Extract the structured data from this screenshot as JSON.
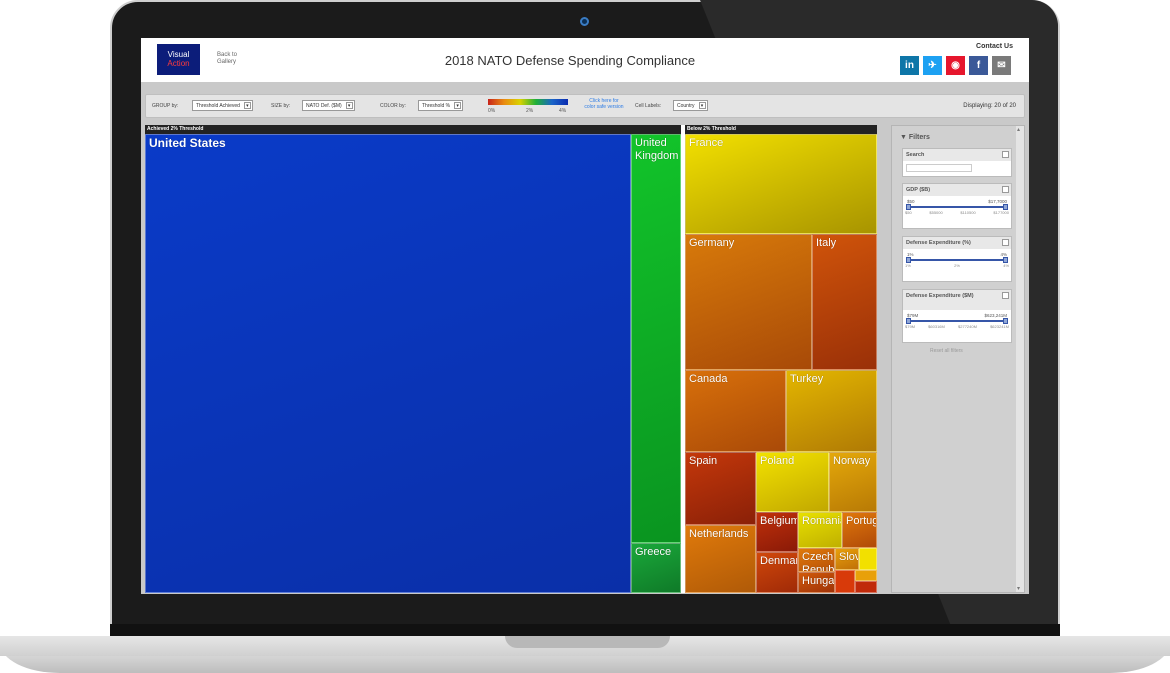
{
  "header": {
    "logo_line1": "Visual",
    "logo_line2": "Action",
    "back_line1": "Back to",
    "back_line2": "Gallery",
    "title": "2018 NATO Defense Spending Compliance",
    "contact": "Contact Us",
    "social": [
      {
        "icon": "linkedin-icon",
        "glyph": "in",
        "color": "#0e76a8"
      },
      {
        "icon": "twitter-icon",
        "glyph": "✈",
        "color": "#1da1f2"
      },
      {
        "icon": "weibo-icon",
        "glyph": "◉",
        "color": "#e6162d"
      },
      {
        "icon": "facebook-icon",
        "glyph": "f",
        "color": "#3b5998"
      },
      {
        "icon": "email-icon",
        "glyph": "✉",
        "color": "#7a7a7a"
      }
    ]
  },
  "controls": {
    "group_label": "GROUP by:",
    "group_value": "Threshold Achieved",
    "size_label": "SIZE by:",
    "size_value": "NATO Def. ($M)",
    "color_label": "COLOR by:",
    "color_value": "Threshold %",
    "legend_ticks": [
      "0%",
      "2%",
      "4%"
    ],
    "color_safe_line1": "Click here for",
    "color_safe_line2": "color safe version",
    "cell_labels_label": "Cell Labels:",
    "cell_labels_value": "Country",
    "displaying": "Displaying: 20 of 20"
  },
  "treemap": {
    "groups": [
      {
        "name": "Achieved 2% Threshold"
      },
      {
        "name": "Below 2% Threshold"
      }
    ],
    "cells": [
      {
        "label": "United States",
        "group": 0,
        "color": "#0a3bc8",
        "gradient": "#0a2fa8"
      },
      {
        "label": "United Kingdom",
        "group": 0,
        "color": "#12c42a",
        "gradient": "#0a9420"
      },
      {
        "label": "Greece",
        "group": 0,
        "color": "#1aa83a",
        "gradient": "#0f7a28"
      },
      {
        "label": "France",
        "group": 1,
        "color": "#f2e000",
        "gradient": "#a89400"
      },
      {
        "label": "Germany",
        "group": 1,
        "color": "#d87a0a",
        "gradient": "#a84a08"
      },
      {
        "label": "Italy",
        "group": 1,
        "color": "#d0540a",
        "gradient": "#9a3008"
      },
      {
        "label": "Canada",
        "group": 1,
        "color": "#d8700a",
        "gradient": "#aa4a08"
      },
      {
        "label": "Turkey",
        "group": 1,
        "color": "#e3b600",
        "gradient": "#b07a05"
      },
      {
        "label": "Spain",
        "group": 1,
        "color": "#c4380a",
        "gradient": "#8a2008"
      },
      {
        "label": "Poland",
        "group": 1,
        "color": "#f2e200",
        "gradient": "#c2a800"
      },
      {
        "label": "Norway",
        "group": 1,
        "color": "#e4a80a",
        "gradient": "#b87a05"
      },
      {
        "label": "Netherlands",
        "group": 1,
        "color": "#e07a0a",
        "gradient": "#b05a08"
      },
      {
        "label": "Belgium",
        "group": 1,
        "color": "#c0300a",
        "gradient": "#8a1a08"
      },
      {
        "label": "Romania",
        "group": 1,
        "color": "#e8e000",
        "gradient": "#c0b000"
      },
      {
        "label": "Portugal",
        "group": 1,
        "color": "#e0780a",
        "gradient": "#b04a08"
      },
      {
        "label": "Denmark",
        "group": 1,
        "color": "#d0480a",
        "gradient": "#a02a08"
      },
      {
        "label": "Czech Republic",
        "group": 1,
        "color": "#e07a0a",
        "gradient": "#b85008"
      },
      {
        "label": "Slovakia",
        "group": 1,
        "color": "#e8a00a",
        "gradient": "#c07008"
      },
      {
        "label": "Hungary",
        "group": 1,
        "color": "#d05a0a",
        "gradient": "#a03208"
      }
    ]
  },
  "filters": {
    "title": "Filters",
    "search_label": "Search",
    "gdp": {
      "label": "GDP ($B)",
      "min": "$50",
      "max": "$17,7000",
      "ticks": [
        "$50",
        "$55000",
        "$110500",
        "$177000"
      ]
    },
    "def_pct": {
      "label": "Defense Expenditure (%)",
      "min": "1%",
      "max": "4%",
      "ticks": [
        "1%",
        "2%",
        "4%"
      ]
    },
    "def_usd": {
      "label": "Defense Expenditure ($M)",
      "min": "$79M",
      "max": "$623,241M",
      "ticks": [
        "$79M",
        "$60316M",
        "$277240M",
        "$623241M"
      ]
    },
    "reset": "Reset all filters"
  }
}
